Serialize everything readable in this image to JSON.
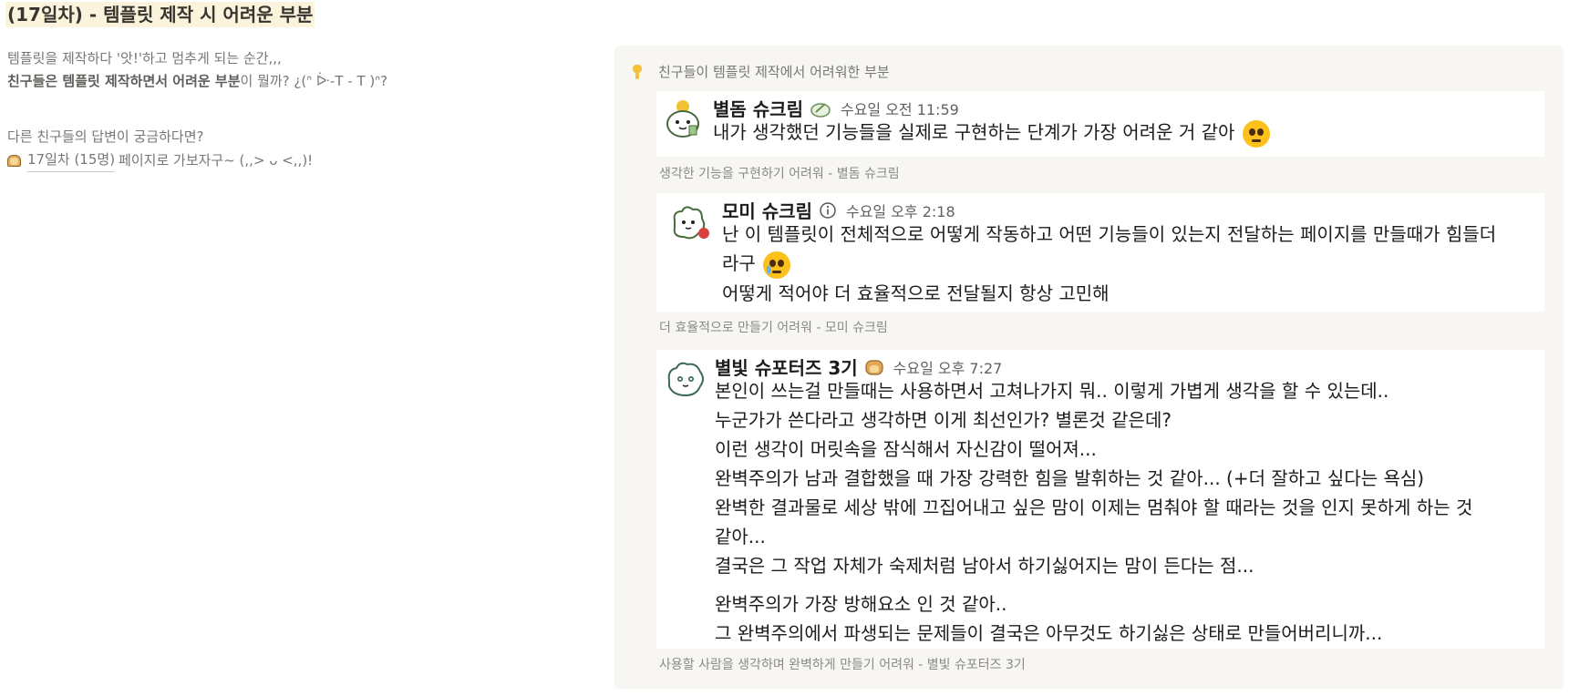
{
  "title": "(17일차) - 템플릿 제작 시 어려운 부분",
  "intro": {
    "line1": "템플릿을 제작하다 '앗!'하고 멈추게 되는 순간,,,",
    "line2_bold1": "친구들은 템플릿 제작하면서 어려운 부분",
    "line2_rest": "이 뭘까? ¿(ᐢ ᐕ-T - T )ᐢ?",
    "line3": "다른 친구들의 답변이 궁금하다면?",
    "link_label": "17일차 (15명)",
    "link_suffix": "페이지로 가보자구~ (,,> ᴗ <,,)!"
  },
  "panel": {
    "header": "친구들이 템플릿 제작에서 어려워한 부분",
    "messages": [
      {
        "author": "별돔 슈크림",
        "time": "수요일 오전 11:59",
        "lines": [
          "내가 생각했던 기능들을 실제로 구현하는 단계가 가장 어려운 거 같아"
        ],
        "caption": "생각한 기능을 구현하기 어려워 - 별돔 슈크림"
      },
      {
        "author": "모미 슈크림",
        "time": "수요일 오후 2:18",
        "lines": [
          "난 이 템플릿이 전체적으로 어떻게 작동하고 어떤 기능들이 있는지 전달하는 페이지를 만들때가 힘들더",
          "라구",
          "어떻게 적어야 더 효율적으로 전달될지 항상 고민해"
        ],
        "caption": "더 효율적으로 만들기 어려워 - 모미 슈크림"
      },
      {
        "author": "별빛 슈포터즈 3기",
        "time": "수요일 오후 7:27",
        "lines": [
          "본인이 쓰는걸 만들때는 사용하면서 고쳐나가지 뭐.. 이렇게 가볍게 생각을 할 수 있는데..",
          "누군가가 쓴다라고 생각하면 이게 최선인가? 별론것 같은데?",
          "이런 생각이 머릿속을 잠식해서 자신감이 떨어져...",
          "완벽주의가 남과 결합했을 때 가장 강력한 힘을 발휘하는 것 같아... (+더 잘하고 싶다는 욕심)",
          "완벽한 결과물로 세상 밖에 끄집어내고 싶은 맘이 이제는 멈춰야 할 때라는 것을 인지 못하게 하는 것",
          "같아...",
          "결국은 그 작업 자체가 숙제처럼 남아서 하기싫어지는 맘이 든다는 점...",
          "완벽주의가 가장 방해요소 인 것 같아..",
          "그 완벽주의에서 파생되는 문제들이 결국은 아무것도 하기싫은 상태로 만들어버리니까..."
        ],
        "caption": "사용할 사람을 생각하며 완벽하게 만들기 어려워 - 별빛 슈포터즈 3기"
      }
    ]
  },
  "icons": {
    "bread": "bread-icon",
    "hand": "pointing-hand-icon",
    "info": "info-icon",
    "badge": "pencil-badge-icon",
    "emoji_pleading": "pleading-face-icon",
    "emoji_crying": "crying-face-icon"
  },
  "colors": {
    "title_highlight": "#fbf3db",
    "panel_bg": "#f7f6f3",
    "card_bg": "#ffffff",
    "muted_text": "#787774"
  }
}
